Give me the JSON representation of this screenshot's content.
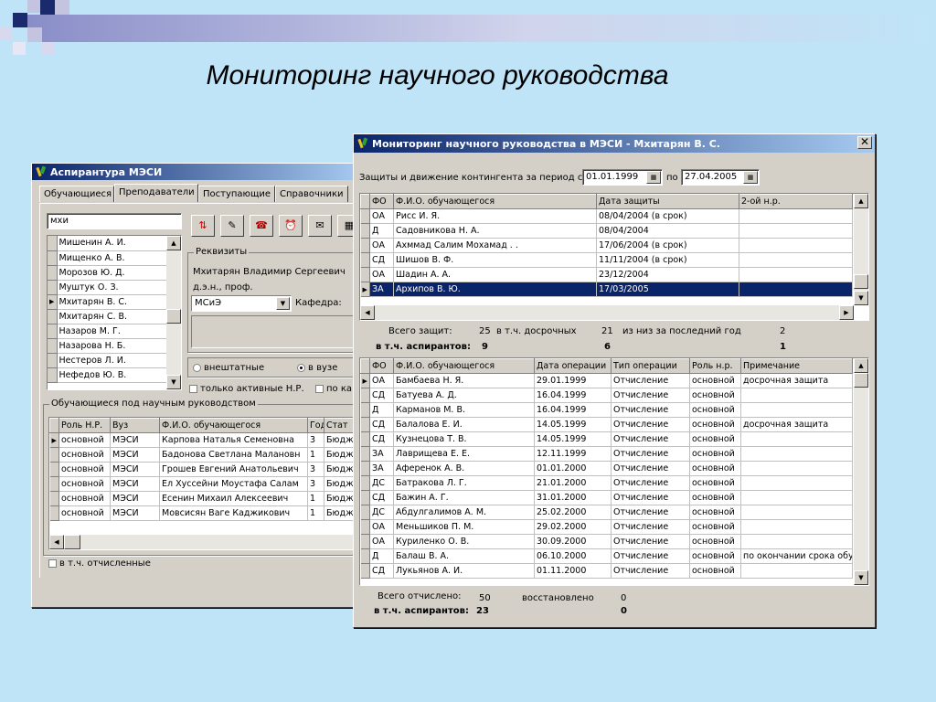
{
  "slide": {
    "title": "Мониторинг научного руководства"
  },
  "back_window": {
    "title": "Аспирантура МЭСИ",
    "tabs": [
      "Обучающиеся",
      "Преподаватели",
      "Поступающие",
      "Справочники"
    ],
    "active_tab": 1,
    "search_value": "мхи",
    "teachers": [
      "Мишенин А. И.",
      "Мищенко А. В.",
      "Морозов Ю. Д.",
      "Муштук О. З.",
      "Мхитарян В. С.",
      "Мхитарян С. В.",
      "Назаров М. Г.",
      "Назарова Н. Б.",
      "Нестеров Л. И.",
      "Нефедов Ю. В."
    ],
    "current_teacher_index": 4,
    "requisites": {
      "group_title": "Реквизиты",
      "name": "Мхитарян Владимир Сергеевич",
      "degree": "д.э.н., проф.",
      "dept_value": "МСиЭ",
      "dept_label": "Кафедра:"
    },
    "radios": {
      "outside": "внештатные",
      "inside": "в вузе",
      "selected": "inside"
    },
    "checkboxes": {
      "only_active": "только активные Н.Р.",
      "by_ka": "по ка"
    },
    "students_group_title": "Обучающиеся под научным руководством",
    "students_headers": [
      "Роль Н.Р.",
      "Вуз",
      "Ф.И.О. обучающегося",
      "Год",
      "Стат"
    ],
    "students": [
      [
        "основной",
        "МЭСИ",
        "Карпова Наталья Семеновна",
        "3",
        "Бюдж"
      ],
      [
        "основной",
        "МЭСИ",
        "Бадонова Светлана Малановн",
        "1",
        "Бюдж"
      ],
      [
        "основной",
        "МЭСИ",
        "Грошев Евгений Анатольевич",
        "3",
        "Бюдж"
      ],
      [
        "основной",
        "МЭСИ",
        "Ел Хуссейни Моустафа Салам",
        "3",
        "Бюдж"
      ],
      [
        "основной",
        "МЭСИ",
        "Есенин Михаил Алексеевич",
        "1",
        "Бюдж"
      ],
      [
        "основной",
        "МЭСИ",
        "Мовсисян Ваге Каджикович",
        "1",
        "Бюдж"
      ]
    ],
    "include_expelled": "в т.ч. отчисленные"
  },
  "front_window": {
    "title": "Мониторинг научного руководства в МЭСИ - Мхитарян В. С.",
    "period_label": "Защиты и движение контингента за период с",
    "date_from": "01.01.1999",
    "to_label": "по",
    "date_to": "27.04.2005",
    "defenses_headers": [
      "ФО",
      "Ф.И.О. обучающегося",
      "Дата защиты",
      "2-ой н.р."
    ],
    "defenses": [
      [
        "ОА",
        "Рисс И. Я.",
        "08/04/2004 (в срок)",
        ""
      ],
      [
        "Д",
        "Садовникова Н. А.",
        "08/04/2004",
        ""
      ],
      [
        "ОА",
        "Ахммад Салим Мохамад . .",
        "17/06/2004 (в срок)",
        ""
      ],
      [
        "СД",
        "Шишов В. Ф.",
        "11/11/2004 (в срок)",
        ""
      ],
      [
        "ОА",
        "Шадин А. А.",
        "23/12/2004",
        ""
      ],
      [
        "ЗА",
        "Архипов В. Ю.",
        "17/03/2005",
        ""
      ]
    ],
    "defenses_selected_index": 5,
    "summary1": {
      "total_label": "Всего защит:",
      "total": "25",
      "early_label": "в т.ч. досрочных",
      "early": "21",
      "last_year_label": "из низ за последний год",
      "last_year": "2",
      "asp_label": "в т.ч. аспирантов:",
      "asp_total": "9",
      "asp_early": "6",
      "asp_last": "1"
    },
    "ops_headers": [
      "ФО",
      "Ф.И.О. обучающегося",
      "Дата операции",
      "Тип операции",
      "Роль н.р.",
      "Примечание"
    ],
    "ops": [
      [
        "ОА",
        "Бамбаева Н. Я.",
        "29.01.1999",
        "Отчисление",
        "основной",
        "досрочная защита"
      ],
      [
        "СД",
        "Батуева А. Д.",
        "16.04.1999",
        "Отчисление",
        "основной",
        ""
      ],
      [
        "Д",
        "Карманов М. В.",
        "16.04.1999",
        "Отчисление",
        "основной",
        ""
      ],
      [
        "СД",
        "Балалова Е. И.",
        "14.05.1999",
        "Отчисление",
        "основной",
        "досрочная защита"
      ],
      [
        "СД",
        "Кузнецова Т. В.",
        "14.05.1999",
        "Отчисление",
        "основной",
        ""
      ],
      [
        "ЗА",
        "Лаврищева Е. Е.",
        "12.11.1999",
        "Отчисление",
        "основной",
        ""
      ],
      [
        "ЗА",
        "Аференок А. В.",
        "01.01.2000",
        "Отчисление",
        "основной",
        ""
      ],
      [
        "ДС",
        "Батракова Л. Г.",
        "21.01.2000",
        "Отчисление",
        "основной",
        ""
      ],
      [
        "СД",
        "Бажин А. Г.",
        "31.01.2000",
        "Отчисление",
        "основной",
        ""
      ],
      [
        "ДС",
        "Абдулгалимов А. М.",
        "25.02.2000",
        "Отчисление",
        "основной",
        ""
      ],
      [
        "ОА",
        "Меньшиков П. М.",
        "29.02.2000",
        "Отчисление",
        "основной",
        ""
      ],
      [
        "ОА",
        "Куриленко О. В.",
        "30.09.2000",
        "Отчисление",
        "основной",
        ""
      ],
      [
        "Д",
        "Балаш В. А.",
        "06.10.2000",
        "Отчисление",
        "основной",
        "по окончании срока обу"
      ],
      [
        "СД",
        "Лукьянов А. И.",
        "01.11.2000",
        "Отчисление",
        "основной",
        ""
      ]
    ],
    "summary2": {
      "expelled_label": "Всего отчислено:",
      "expelled": "50",
      "restored_label": "восстановлено",
      "restored": "0",
      "asp_label": "в т.ч. аспирантов:",
      "asp_expelled": "23",
      "asp_restored": "0"
    }
  },
  "colors": {
    "background": "#bfe4f8",
    "window": "#d4d0c8",
    "titlebar": "#0a246a",
    "selection": "#0a246a",
    "deco_dark": "#1a2a6c",
    "deco_light": "#c4c4e0"
  }
}
